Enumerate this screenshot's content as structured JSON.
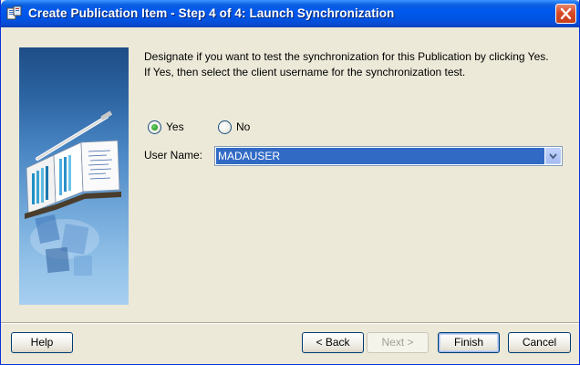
{
  "window": {
    "title": "Create Publication Item - Step 4 of 4: Launch Synchronization"
  },
  "content": {
    "description": "Designate if you want to test the synchronization for this Publication by clicking Yes. If Yes, then select the client username for the synchronization test.",
    "radio_yes_label": "Yes",
    "radio_no_label": "No",
    "selected_option": "Yes",
    "user_name_label": "User Name:",
    "user_name_value": "MADAUSER"
  },
  "buttons": {
    "help": "Help",
    "back": "< Back",
    "next": "Next >",
    "finish": "Finish",
    "cancel": "Cancel"
  },
  "colors": {
    "titlebar": "#0054e3",
    "selection": "#316ac5",
    "radio_checked": "#2fa52b"
  }
}
